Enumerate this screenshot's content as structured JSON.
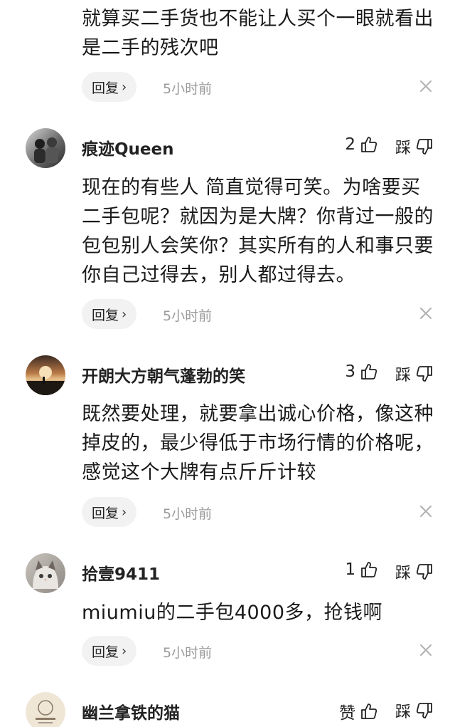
{
  "comments": [
    {
      "text": "就算买二手货也不能让人买个一眼就看出是二手的残次吧",
      "reply_label": "回复",
      "time": "5小时前"
    },
    {
      "username": "痕迹Queen",
      "likes": "2",
      "dislike_label": "踩",
      "text": "现在的有些人 简直觉得可笑。为啥要买二手包呢？就因为是大牌？你背过一般的包包别人会笑你？其实所有的人和事只要你自己过得去，别人都过得去。",
      "reply_label": "回复",
      "time": "5小时前"
    },
    {
      "username": "开朗大方朝气蓬勃的笑",
      "likes": "3",
      "dislike_label": "踩",
      "text": "既然要处理，就要拿出诚心价格，像这种掉皮的，最少得低于市场行情的价格呢，感觉这个大牌有点斤斤计较",
      "reply_label": "回复",
      "time": "5小时前"
    },
    {
      "username": "拾壹9411",
      "likes": "1",
      "dislike_label": "踩",
      "text": "miumiu的二手包4000多，抢钱啊",
      "reply_label": "回复",
      "time": "5小时前"
    },
    {
      "username": "幽兰拿铁的猫",
      "likes": "赞",
      "dislike_label": "踩"
    }
  ],
  "icons": {
    "like": "thumb-up-icon",
    "dislike": "thumb-down-icon",
    "close": "close-icon",
    "reply": "chevron-right-icon"
  },
  "colors": {
    "reply_bg": "#f2f2f2",
    "time_gray": "#9a9a9a"
  }
}
